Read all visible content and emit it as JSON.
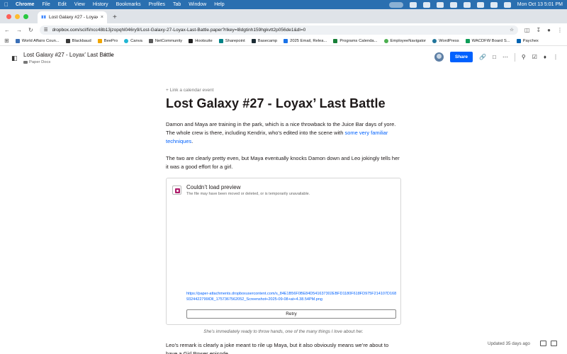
{
  "menubar": {
    "app": "Chrome",
    "items": [
      "File",
      "Edit",
      "View",
      "History",
      "Bookmarks",
      "Profiles",
      "Tab",
      "Window",
      "Help"
    ],
    "clock": "Mon Oct 13  5:01 PM"
  },
  "tab": {
    "title": "Lost Galaxy #27 - Loyax' Last",
    "close": "×",
    "new_tab": "+"
  },
  "address": {
    "url_host": "dropbox.com",
    "url_path": "/scl/fi/ncc48b13jzopqhl046ry9/Lost-Galaxy-27-Loyax-Last-Battle.paper?rlkey=l8dgtinh159hgkvtt2p056de1&dl=0"
  },
  "bookmarks": [
    {
      "label": "World Affairs Coun...",
      "color": "#3b6fb6"
    },
    {
      "label": "Blackbaud",
      "color": "#3a3a3a"
    },
    {
      "label": "BeePro",
      "color": "#f0a500"
    },
    {
      "label": "Canva",
      "color": "#21b6d3"
    },
    {
      "label": "NetCommunity",
      "color": "#5a5a5a"
    },
    {
      "label": "Hootsuite",
      "color": "#222222"
    },
    {
      "label": "Sharepoint",
      "color": "#038387"
    },
    {
      "label": "Basecamp",
      "color": "#1d2d35"
    },
    {
      "label": "2025 Email, Relea...",
      "color": "#1a73e8"
    },
    {
      "label": "Programs Calenda...",
      "color": "#188038"
    },
    {
      "label": "EmployeeNavigator",
      "color": "#4caf50"
    },
    {
      "label": "WordPress",
      "color": "#21759b"
    },
    {
      "label": "WACDFW Board S...",
      "color": "#0f9d58"
    },
    {
      "label": "Paychex",
      "color": "#0063b1"
    }
  ],
  "header": {
    "title": "Lost Galaxy #27 - Loyax’ Last Battle",
    "star": "☆",
    "folder": "Paper Docs",
    "share_label": "Share"
  },
  "doc": {
    "calendar_link": "+ Link a calendar event",
    "title": "Lost Galaxy #27 - Loyax’ Last Battle",
    "para1_start": "Damon and Maya are training in the park, which is a nice throwback to the Juice Bar days of yore. The whole crew is there, including Kendrix, who’s edited into the scene with ",
    "para1_link": "some very familiar techniques",
    "para1_end": ".",
    "para2": "The two are clearly pretty even, but Maya eventually knocks Damon down and Leo jokingly tells her it was a good effort for a girl.",
    "embed": {
      "title": "Couldn’t load preview",
      "subtitle": "The file may have been moved or deleted, or is temporarily unavailable.",
      "url": "https://paper-attachments.dropboxusercontent.com/s_84E1B56F0BE84D541637302EBFD1180F618FD975F214107D1689324422799IDll_1757367562052_Screenshot+2025-09-08+at+4.38.54PM.png",
      "retry": "Retry"
    },
    "caption": "She’s immediately ready to throw hands, one of the many things I love about her.",
    "para3": "Leo’s remark is clearly a joke meant to rile up Maya, but it also obviously means we’re about to have a Girl Power episode."
  },
  "footer": {
    "updated": "Updated 35 days ago"
  }
}
